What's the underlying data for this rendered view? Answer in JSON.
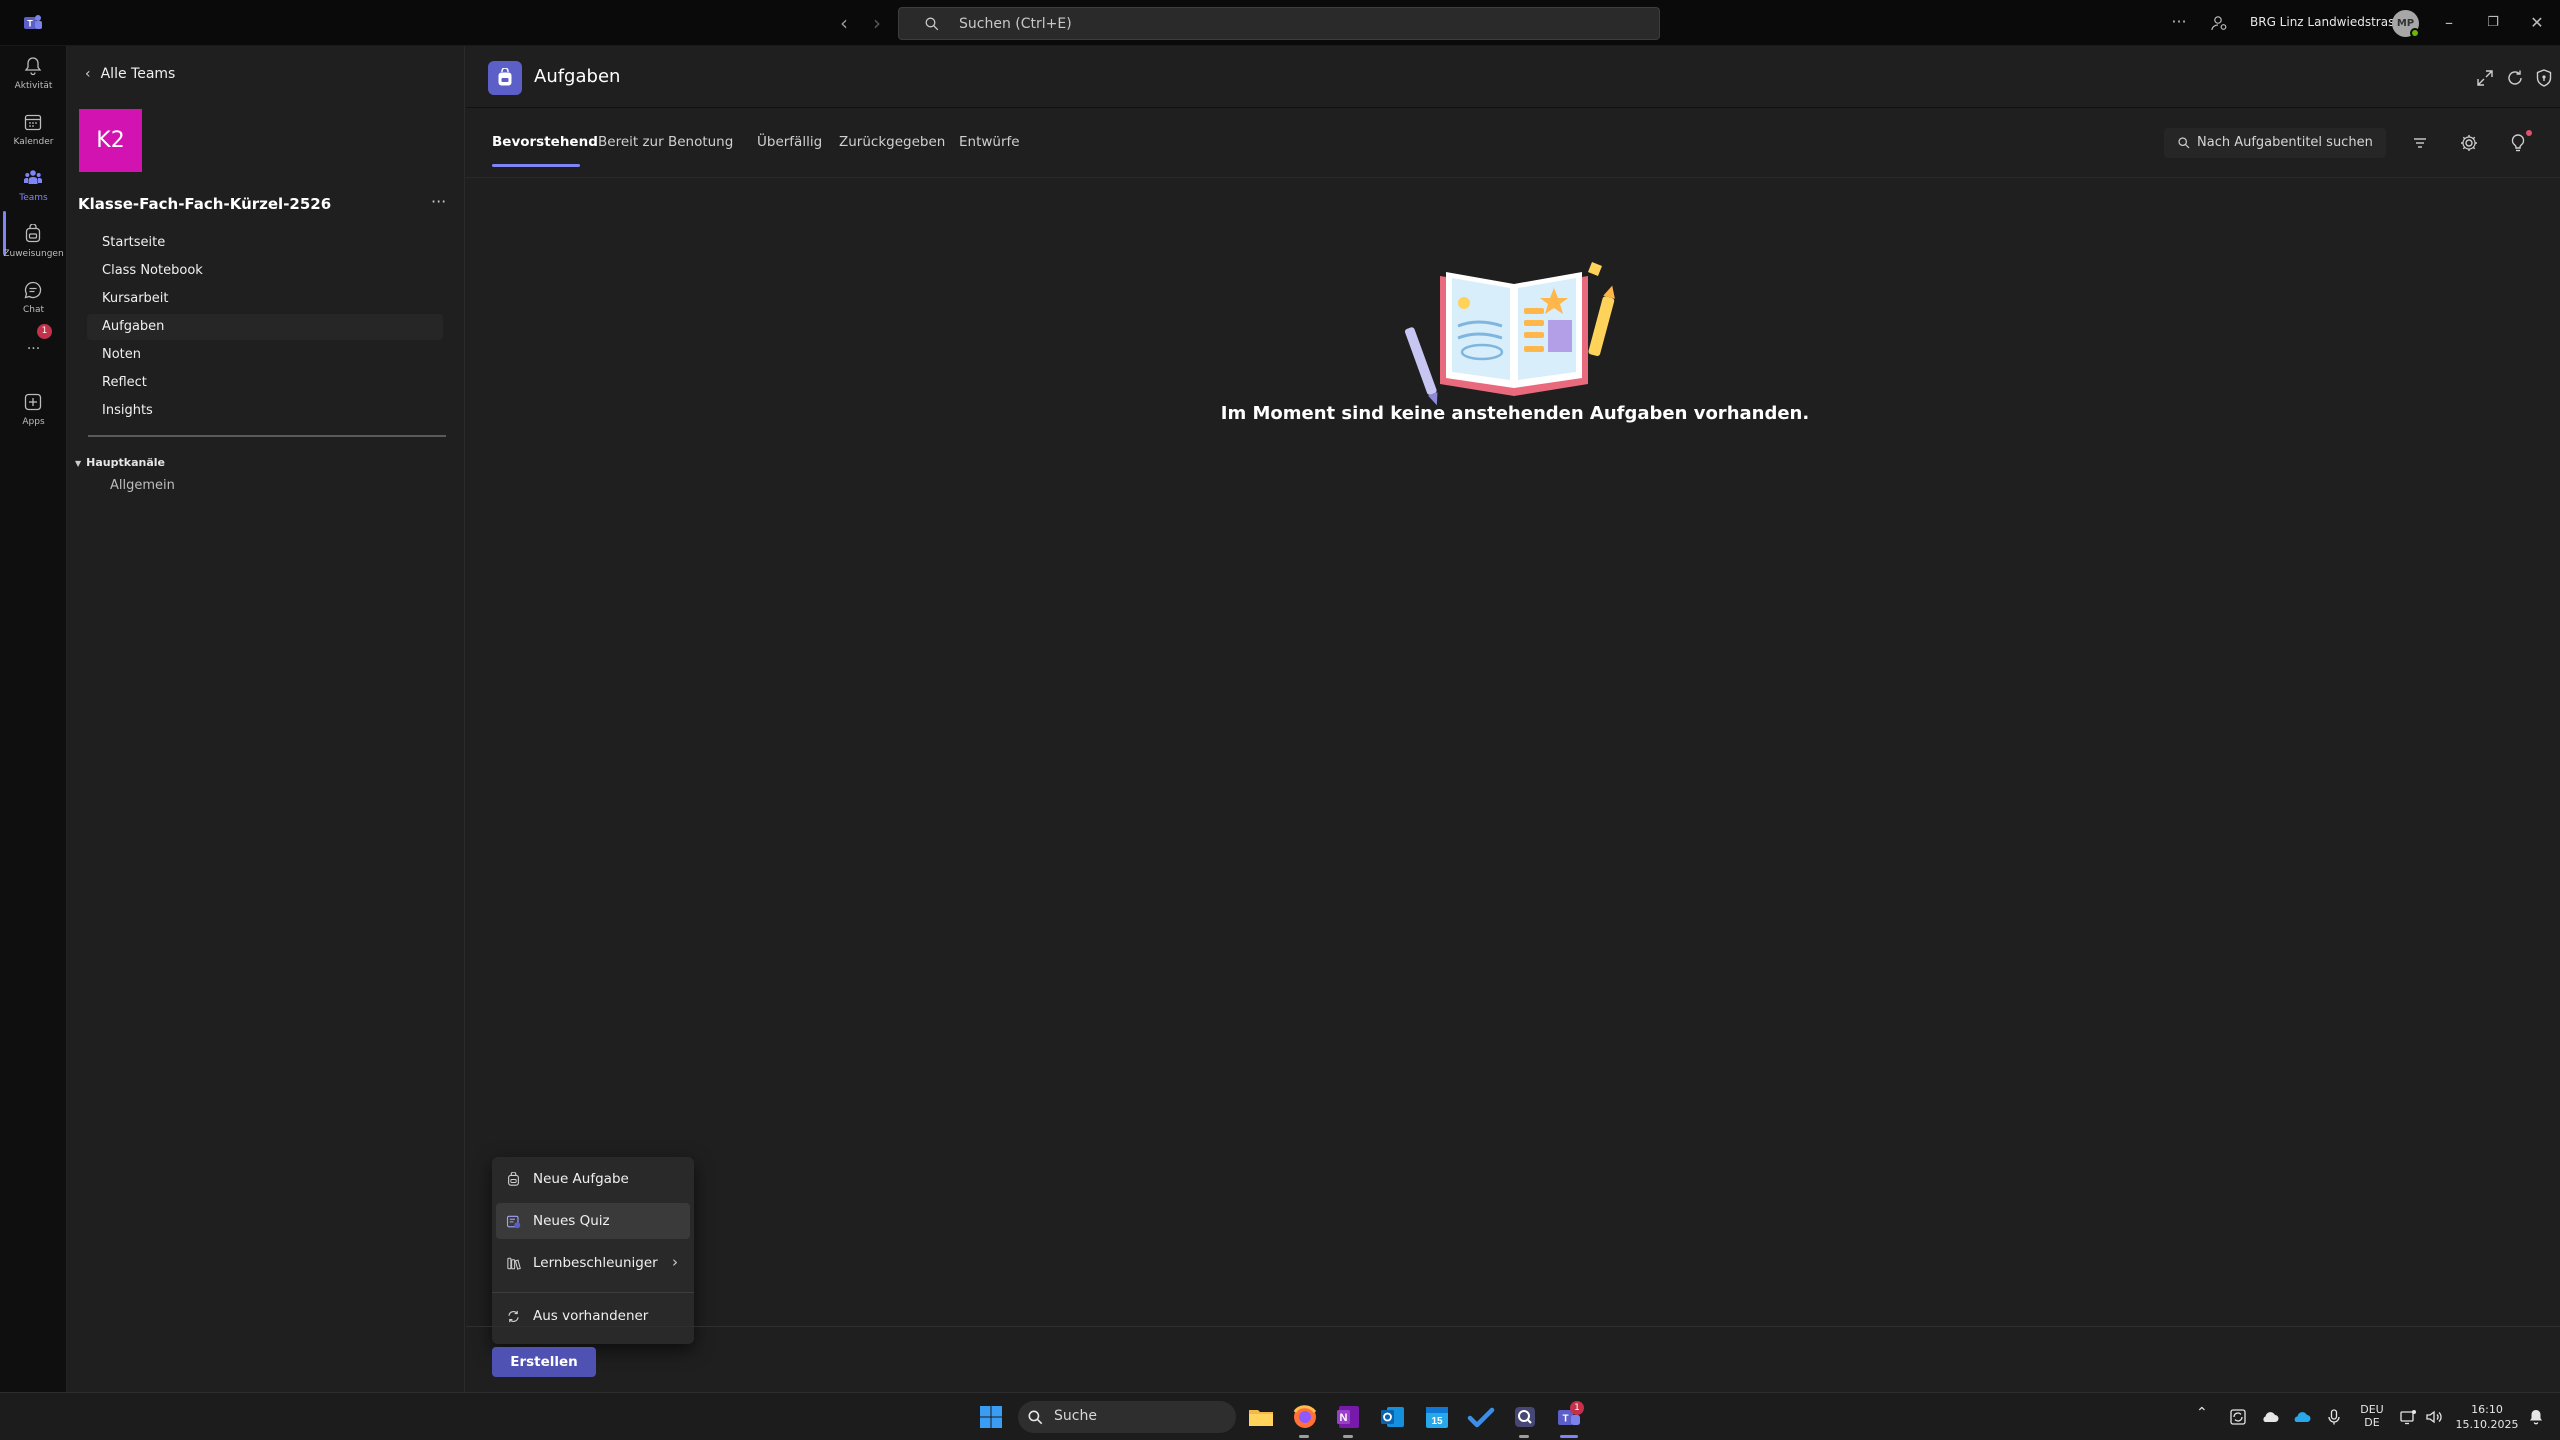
{
  "titlebar": {
    "search_placeholder": "Suchen (Ctrl+E)",
    "org_name": "BRG Linz Landwiedstrasse",
    "avatar_initials": "MP"
  },
  "rail": {
    "items": [
      {
        "label": "Aktivität"
      },
      {
        "label": "Kalender"
      },
      {
        "label": "Teams"
      },
      {
        "label": "Zuweisungen"
      },
      {
        "label": "Chat"
      },
      {
        "label": "..."
      },
      {
        "label": "Apps"
      }
    ],
    "chat_badge": "1"
  },
  "sidebar": {
    "back_label": "Alle Teams",
    "team_initials": "K2",
    "team_name": "Klasse-Fach-Fach-Kürzel-2526",
    "more": "···",
    "nav": [
      {
        "label": "Startseite"
      },
      {
        "label": "Class Notebook"
      },
      {
        "label": "Kursarbeit"
      },
      {
        "label": "Aufgaben"
      },
      {
        "label": "Noten"
      },
      {
        "label": "Reflect"
      },
      {
        "label": "Insights"
      }
    ],
    "section_label": "Hauptkanäle",
    "channel_label": "Allgemein"
  },
  "main": {
    "app_title": "Aufgaben",
    "tabs": [
      {
        "label": "Bevorstehend"
      },
      {
        "label": "Bereit zur Benotung"
      },
      {
        "label": "Überfällig"
      },
      {
        "label": "Zurückgegeben"
      },
      {
        "label": "Entwürfe"
      }
    ],
    "search_placeholder": "Nach Aufgabentitel suchen",
    "empty_message": "Im Moment sind keine anstehenden Aufgaben vorhanden."
  },
  "menu": {
    "items": [
      {
        "label": "Neue Aufgabe"
      },
      {
        "label": "Neues Quiz"
      },
      {
        "label": "Lernbeschleuniger"
      },
      {
        "label": "Aus vorhandener"
      }
    ]
  },
  "footer": {
    "create_label": "Erstellen"
  },
  "taskbar": {
    "search_label": "Suche",
    "teams_badge": "1",
    "lang_top": "DEU",
    "lang_bottom": "DE",
    "time": "16:10",
    "date": "15.10.2025"
  },
  "colors": {
    "accent": "#7f85f5",
    "brand_button": "#4f52b2",
    "team_tile": "#d213b1",
    "badge_red": "#c4314b"
  }
}
